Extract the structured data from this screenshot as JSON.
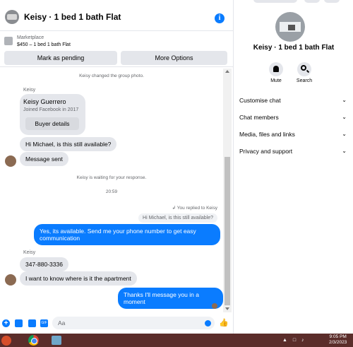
{
  "header": {
    "title": "Keisy · 1 bed 1 bath Flat"
  },
  "listing": {
    "source": "Marketplace",
    "price_title": "$450 – 1 bed 1 bath Flat",
    "pending_label": "Mark as pending",
    "more_label": "More Options"
  },
  "messages": {
    "group_photo": "Keisy changed the group photo.",
    "sender_1": "Keisy",
    "card_name": "Keisy Guerrero",
    "card_joined": "Joined Facebook in 2017",
    "buyer_details": "Buyer details",
    "msg_available": "Hi Michael, is this still available?",
    "msg_sent": "Message sent",
    "waiting": "Keisy is waiting for your response.",
    "time": "20:59",
    "replied_to": "You replied to Keisy",
    "quoted": "Hi Michael, is this still available?",
    "reply": "Yes, its available. Send me your phone number to get easy communication",
    "sender_2": "Keisy",
    "phone": "347-880-3336",
    "where": "I want to know where is it the apartment",
    "thanks": "Thanks I'll message you in a moment"
  },
  "composer": {
    "placeholder": "Aa"
  },
  "side": {
    "title": "Keisy · 1 bed 1 bath Flat",
    "mute_label": "Mute",
    "search_label": "Search",
    "rows": [
      {
        "label": "Customise chat"
      },
      {
        "label": "Chat members"
      },
      {
        "label": "Media, files and links"
      },
      {
        "label": "Privacy and support"
      }
    ]
  },
  "taskbar": {
    "time": "9:05 PM",
    "date": "2/3/2023"
  },
  "colors": {
    "accent": "#0a7cff",
    "bubble_in": "#e4e6eb",
    "taskbar": "#5b2d2a"
  }
}
